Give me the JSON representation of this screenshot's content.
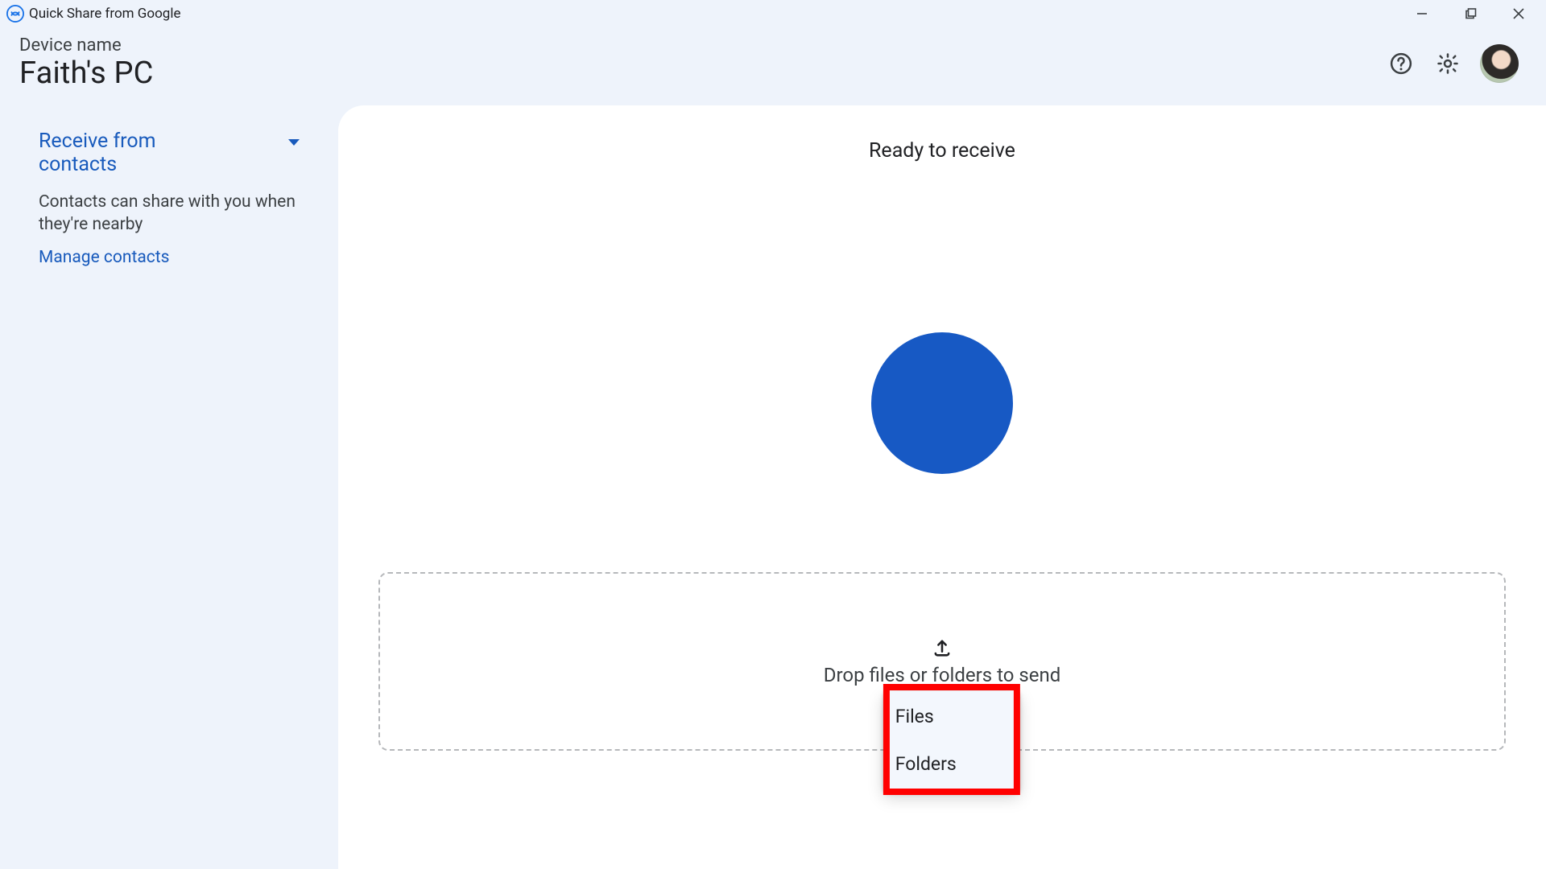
{
  "titlebar": {
    "app_title": "Quick Share from Google"
  },
  "header": {
    "device_label": "Device name",
    "device_name": "Faith's PC"
  },
  "sidebar": {
    "visibility_label": "Receive from contacts",
    "visibility_description": "Contacts can share with you when they're nearby",
    "manage_contacts": "Manage contacts"
  },
  "main": {
    "ready_text": "Ready to receive",
    "drop_text": "Drop files or folders to send"
  },
  "menu": {
    "files": "Files",
    "folders": "Folders"
  },
  "colors": {
    "accent": "#185abc",
    "pulse": "#1759c4",
    "panel_bg": "#ffffff",
    "app_bg": "#eef3fb"
  }
}
